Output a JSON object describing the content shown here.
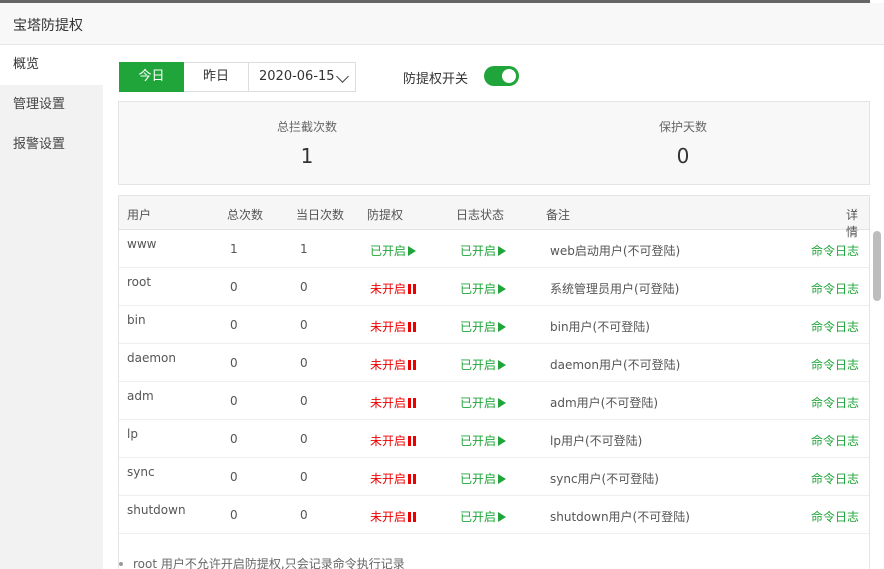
{
  "window": {
    "title": "宝塔防提权"
  },
  "sidebar": {
    "items": [
      {
        "label": "概览"
      },
      {
        "label": "管理设置"
      },
      {
        "label": "报警设置"
      }
    ]
  },
  "toolbar": {
    "today_label": "今日",
    "yesterday_label": "昨日",
    "date_value": "2020-06-15",
    "switch_label": "防提权开关",
    "switch_on": true
  },
  "stats": {
    "total_label": "总拦截次数",
    "total_value": "1",
    "days_label": "保护天数",
    "days_value": "0"
  },
  "table": {
    "headers": [
      "用户",
      "总次数",
      "当日次数",
      "防提权",
      "日志状态",
      "备注",
      "详情"
    ],
    "rows": [
      {
        "user": "www",
        "total": "1",
        "today": "1",
        "protect": "已开启",
        "protect_on": true,
        "log": "已开启",
        "note": "web启动用户(不可登陆)",
        "detail": "命令日志"
      },
      {
        "user": "root",
        "total": "0",
        "today": "0",
        "protect": "未开启",
        "protect_on": false,
        "log": "已开启",
        "note": "系统管理员用户(可登陆)",
        "detail": "命令日志"
      },
      {
        "user": "bin",
        "total": "0",
        "today": "0",
        "protect": "未开启",
        "protect_on": false,
        "log": "已开启",
        "note": "bin用户(不可登陆)",
        "detail": "命令日志"
      },
      {
        "user": "daemon",
        "total": "0",
        "today": "0",
        "protect": "未开启",
        "protect_on": false,
        "log": "已开启",
        "note": "daemon用户(不可登陆)",
        "detail": "命令日志"
      },
      {
        "user": "adm",
        "total": "0",
        "today": "0",
        "protect": "未开启",
        "protect_on": false,
        "log": "已开启",
        "note": "adm用户(不可登陆)",
        "detail": "命令日志"
      },
      {
        "user": "lp",
        "total": "0",
        "today": "0",
        "protect": "未开启",
        "protect_on": false,
        "log": "已开启",
        "note": "lp用户(不可登陆)",
        "detail": "命令日志"
      },
      {
        "user": "sync",
        "total": "0",
        "today": "0",
        "protect": "未开启",
        "protect_on": false,
        "log": "已开启",
        "note": "sync用户(不可登陆)",
        "detail": "命令日志"
      },
      {
        "user": "shutdown",
        "total": "0",
        "today": "0",
        "protect": "未开启",
        "protect_on": false,
        "log": "已开启",
        "note": "shutdown用户(不可登陆)",
        "detail": "命令日志"
      }
    ]
  },
  "footer_note": "root 用户不允许开启防提权,只会记录命令执行记录",
  "colors": {
    "accent": "#20a53a",
    "danger": "#ee0000"
  }
}
